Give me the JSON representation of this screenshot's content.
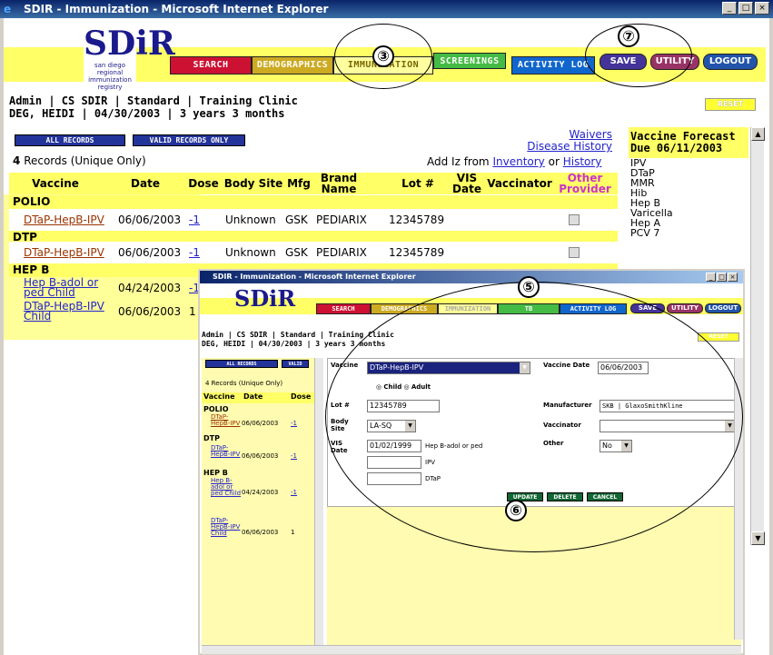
{
  "window": {
    "title": "SDIR - Immunization - Microsoft Internet Explorer",
    "min": "_",
    "max": "□",
    "close": "×"
  },
  "logo": {
    "letters": "SDiR",
    "sub": "san diego regional immunization registry"
  },
  "tabs": {
    "search": "SEARCH",
    "demographics": "DEMOGRAPHICS",
    "immunization": "IMMUNIZATION",
    "screenings": "SCREENINGS",
    "activity_log": "ACTIVITY LOG"
  },
  "actions": {
    "save": "SAVE",
    "utility": "UTILITY",
    "logout": "LOGOUT",
    "reset": "RESET"
  },
  "patient": {
    "line1": "Admin | CS SDIR | Standard | Training Clinic",
    "line2": "DEG, HEIDI | 04/30/2003 | 3 years 3 months"
  },
  "nav": {
    "all_records": "ALL RECORDS",
    "valid_only": "VALID RECORDS ONLY"
  },
  "links": {
    "waivers": "Waivers",
    "disease_history": "Disease History",
    "add_iz_prefix": "Add Iz from",
    "inventory": "Inventory",
    "or": "or",
    "history": "History"
  },
  "records": {
    "count": "4",
    "label": "Records (Unique Only)"
  },
  "columns": {
    "vaccine": "Vaccine",
    "date": "Date",
    "dose": "Dose",
    "body_site": "Body Site",
    "mfg": "Mfg",
    "brand": "Brand Name",
    "lot": "Lot #",
    "vis": "VIS Date",
    "vaccinator": "Vaccinator",
    "other": "Other Provider"
  },
  "groups": [
    {
      "name": "POLIO",
      "rows": [
        {
          "vaccine": "DTaP-HepB-IPV",
          "date": "06/06/2003",
          "dose": "-1",
          "site": "Unknown",
          "mfg": "GSK",
          "brand": "PEDIARIX",
          "lot": "12345789"
        }
      ]
    },
    {
      "name": "DTP",
      "rows": [
        {
          "vaccine": "DTaP-HepB-IPV",
          "date": "06/06/2003",
          "dose": "-1",
          "site": "Unknown",
          "mfg": "GSK",
          "brand": "PEDIARIX",
          "lot": "12345789"
        }
      ]
    },
    {
      "name": "HEP B",
      "rows": [
        {
          "vaccine": "Hep B-adol or ped Child",
          "date": "04/24/2003",
          "dose": "-1"
        },
        {
          "vaccine": "DTaP-HepB-IPV Child",
          "date": "06/06/2003",
          "dose": "1"
        }
      ]
    }
  ],
  "forecast": {
    "title1": "Vaccine Forecast",
    "title2": "Due 06/11/2003",
    "items": [
      "IPV",
      "DTaP",
      "MMR",
      "Hib",
      "Hep B",
      "Varicella",
      "Hep A",
      "PCV 7"
    ]
  },
  "popup": {
    "title": "SDIR - Immunization - Microsoft Internet Explorer",
    "tabs": {
      "search": "SEARCH",
      "demographics": "DEMOGRAPHICS",
      "immunization": "IMMUNIZATION",
      "tb": "TB",
      "activity_log": "ACTIVITY LOG"
    },
    "actions": {
      "save": "SAVE",
      "utility": "UTILITY",
      "logout": "LOGOUT",
      "reset": "RESET"
    },
    "patient1": "Admin | CS SDIR | Standard | Training Clinic",
    "patient2": "DEG, HEIDI | 04/30/2003 | 3 years 3 months",
    "nav": {
      "all": "ALL RECORDS",
      "valid": "VALID"
    },
    "count": "4 Records (Unique Only)",
    "cols": {
      "vaccine": "Vaccine",
      "date": "Date",
      "dose": "Dose"
    },
    "list": [
      {
        "group": "POLIO",
        "vaccine": "DTaP-HepB-IPV",
        "date": "06/06/2003",
        "dose": "-1"
      },
      {
        "group": "DTP",
        "vaccine": "DTaP-HepB-IPV",
        "date": "06/06/2003",
        "dose": "-1"
      },
      {
        "group": "HEP B",
        "vaccine": "Hep B-adol or ped Child",
        "date": "04/24/2003",
        "dose": "-1"
      },
      {
        "group": "",
        "vaccine": "DTaP-HepB-IPV Child",
        "date": "06/06/2003",
        "dose": "1"
      }
    ],
    "form": {
      "vaccine_label": "Vaccine",
      "vaccine_value": "DTaP-HepB-IPV",
      "date_label": "Vaccine Date",
      "date_value": "06/06/2003",
      "child": "Child",
      "adult": "Adult",
      "lot_label": "Lot #",
      "lot_value": "12345789",
      "mfr_label": "Manufacturer",
      "mfr_value": "SKB | GlaxoSmithKline",
      "site_label": "Body Site",
      "site_value": "LA-SQ",
      "vaccinator_label": "Vaccinator",
      "vis_label": "VIS Date",
      "vis_value": "01/02/1999",
      "vis_text1": "Hep B-adol or ped",
      "vis_text2": "IPV",
      "vis_text3": "DTaP",
      "other_label": "Other",
      "other_value": "No",
      "update": "UPDATE",
      "delete": "DELETE",
      "cancel": "CANCEL"
    }
  },
  "callouts": {
    "c3": "③",
    "c5": "⑤",
    "c6": "⑥",
    "c7": "⑦"
  }
}
